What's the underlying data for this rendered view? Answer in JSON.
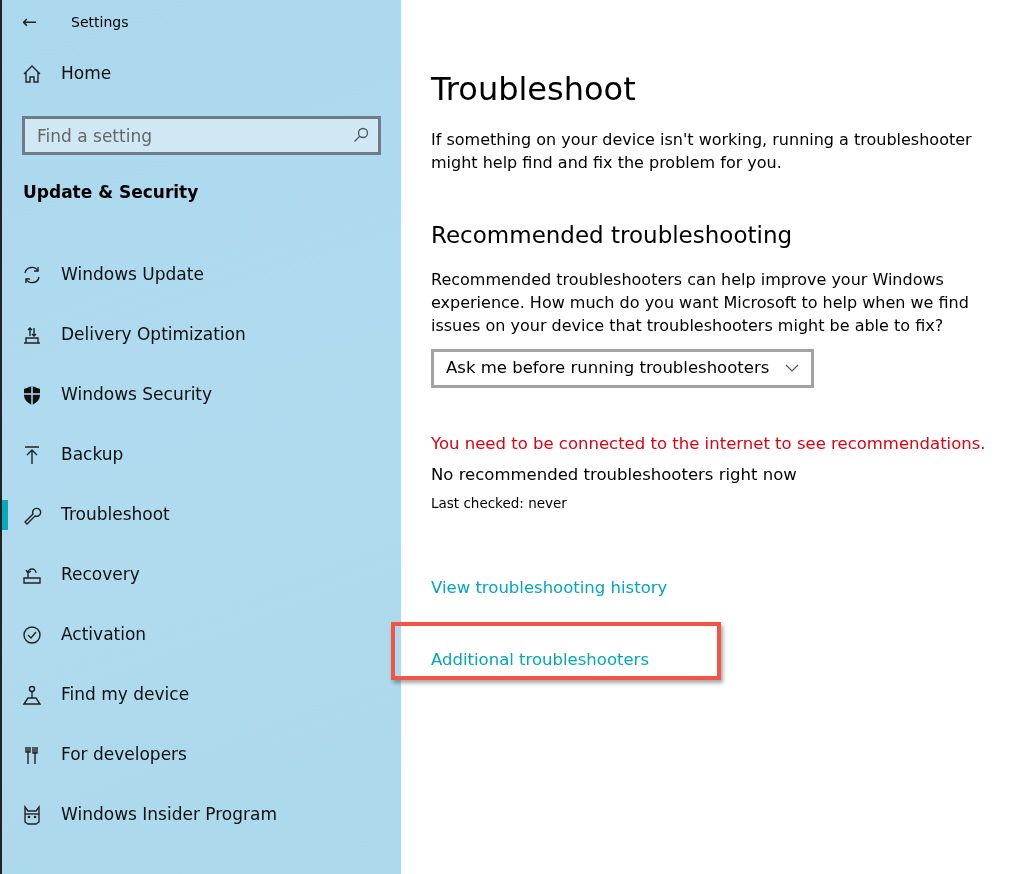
{
  "window": {
    "title": "Settings",
    "back": "←"
  },
  "sidebar": {
    "home": "Home",
    "search": {
      "placeholder": "Find a setting"
    },
    "section": "Update & Security",
    "items": [
      {
        "label": "Windows Update",
        "selected": false
      },
      {
        "label": "Delivery Optimization",
        "selected": false
      },
      {
        "label": "Windows Security",
        "selected": false
      },
      {
        "label": "Backup",
        "selected": false
      },
      {
        "label": "Troubleshoot",
        "selected": true
      },
      {
        "label": "Recovery",
        "selected": false
      },
      {
        "label": "Activation",
        "selected": false
      },
      {
        "label": "Find my device",
        "selected": false
      },
      {
        "label": "For developers",
        "selected": false
      },
      {
        "label": "Windows Insider Program",
        "selected": false
      }
    ]
  },
  "main": {
    "title": "Troubleshoot",
    "intro": "If something on your device isn't working, running a troubleshooter might help find and fix the problem for you.",
    "heading": "Recommended troubleshooting",
    "description": "Recommended troubleshooters can help improve your Windows experience. How much do you want Microsoft to help when we find issues on your device that troubleshooters might be able to fix?",
    "dropdown": {
      "value": "Ask me before running troubleshooters"
    },
    "warning": "You need to be connected to the internet to see recommendations.",
    "status": "No recommended troubleshooters right now",
    "last_checked": "Last checked: never",
    "links": [
      {
        "label": "View troubleshooting history",
        "highlighted": false
      },
      {
        "label": "Additional troubleshooters",
        "highlighted": true
      }
    ]
  }
}
